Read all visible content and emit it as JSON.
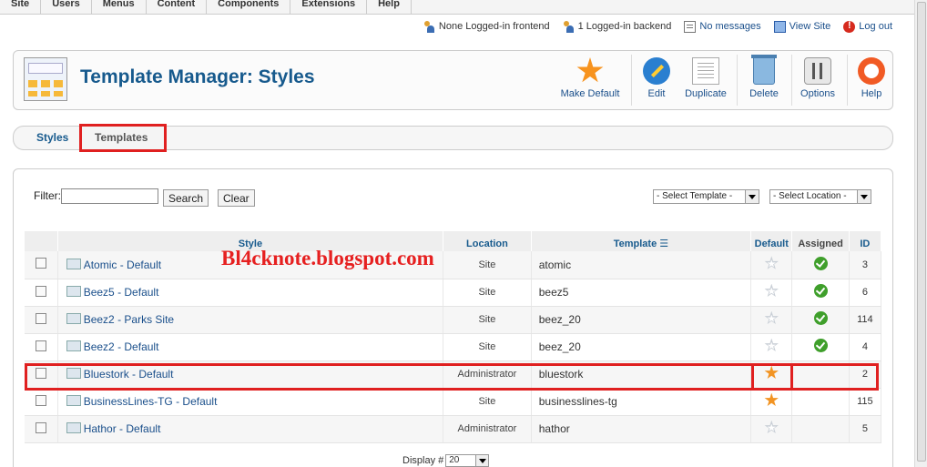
{
  "topmenu": [
    "Site",
    "Users",
    "Menus",
    "Content",
    "Components",
    "Extensions",
    "Help"
  ],
  "status": {
    "frontend": "None Logged-in frontend",
    "backend": "1 Logged-in backend",
    "messages": "No messages",
    "view_site": "View Site",
    "logout": "Log out"
  },
  "toolbar": {
    "title": "Template Manager: Styles",
    "make_default": "Make Default",
    "edit": "Edit",
    "duplicate": "Duplicate",
    "delete": "Delete",
    "options": "Options",
    "help": "Help"
  },
  "tabs": {
    "styles": "Styles",
    "templates": "Templates"
  },
  "filter": {
    "label": "Filter:",
    "value": "",
    "search": "Search",
    "clear": "Clear",
    "select_template": "- Select Template -",
    "select_location": "- Select Location -"
  },
  "table": {
    "headers": {
      "style": "Style",
      "location": "Location",
      "template": "Template",
      "default": "Default",
      "assigned": "Assigned",
      "id": "ID"
    },
    "rows": [
      {
        "style": "Atomic - Default",
        "location": "Site",
        "template": "atomic",
        "default": false,
        "assigned": true,
        "id": "3"
      },
      {
        "style": "Beez5 - Default",
        "location": "Site",
        "template": "beez5",
        "default": false,
        "assigned": true,
        "id": "6"
      },
      {
        "style": "Beez2 - Parks Site",
        "location": "Site",
        "template": "beez_20",
        "default": false,
        "assigned": true,
        "id": "114"
      },
      {
        "style": "Beez2 - Default",
        "location": "Site",
        "template": "beez_20",
        "default": false,
        "assigned": true,
        "id": "4"
      },
      {
        "style": "Bluestork - Default",
        "location": "Administrator",
        "template": "bluestork",
        "default": true,
        "assigned": false,
        "id": "2"
      },
      {
        "style": "BusinessLines-TG - Default",
        "location": "Site",
        "template": "businesslines-tg",
        "default": true,
        "assigned": false,
        "id": "115"
      },
      {
        "style": "Hathor - Default",
        "location": "Administrator",
        "template": "hathor",
        "default": false,
        "assigned": false,
        "id": "5"
      }
    ]
  },
  "watermark": "Bl4cknote.blogspot.com",
  "pagination": {
    "label": "Display #",
    "value": "20"
  },
  "colors": {
    "title": "#175a8d",
    "link": "#1a4f8b",
    "highlight": "#e02020",
    "star": "#f29423",
    "check": "#3f9f2b"
  }
}
